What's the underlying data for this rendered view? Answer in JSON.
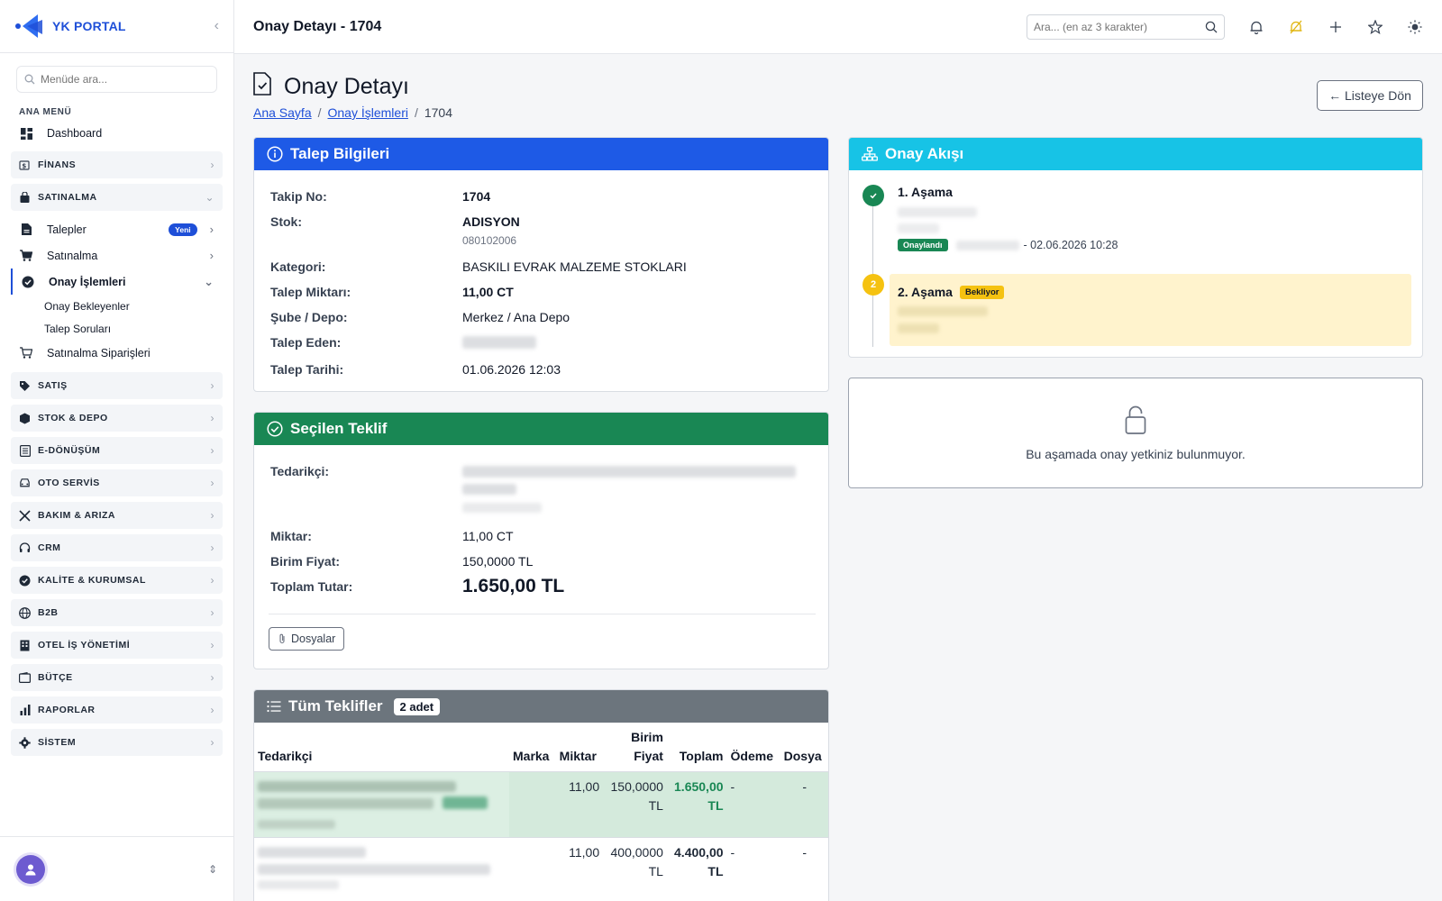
{
  "brand": {
    "name": "YK PORTAL"
  },
  "sidebar": {
    "search_placeholder": "Menüde ara...",
    "section_title": "ANA MENÜ",
    "dashboard": "Dashboard",
    "groups": {
      "finans": "FİNANS",
      "satinalma": "SATINALMA",
      "satis": "SATIŞ",
      "stok": "STOK & DEPO",
      "edonusum": "E-DÖNÜŞÜM",
      "oto": "OTO SERVİS",
      "bakim": "BAKIM & ARIZA",
      "crm": "CRM",
      "kalite": "KALİTE & KURUMSAL",
      "b2b": "B2B",
      "otel": "OTEL İŞ YÖNETİMİ",
      "butce": "BÜTÇE",
      "raporlar": "RAPORLAR",
      "sistem": "SİSTEM"
    },
    "satinalma_items": {
      "talepler": "Talepler",
      "talepler_badge": "Yeni",
      "satinalma": "Satınalma",
      "onay": "Onay İşlemleri",
      "onay_bekleyenler": "Onay Bekleyenler",
      "talep_sorulari": "Talep Soruları",
      "siparisler": "Satınalma Siparişleri"
    }
  },
  "topbar": {
    "title": "Onay Detayı - 1704",
    "search_placeholder": "Ara... (en az 3 karakter)"
  },
  "page": {
    "title": "Onay Detayı",
    "breadcrumb": {
      "home": "Ana Sayfa",
      "section": "Onay İşlemleri",
      "current": "1704"
    },
    "back_label": "← Listeye Dön"
  },
  "talep": {
    "header": "Talep Bilgileri",
    "takip_label": "Takip No:",
    "takip_value": "1704",
    "stok_label": "Stok:",
    "stok_value": "ADISYON",
    "stok_code": "080102006",
    "kategori_label": "Kategori:",
    "kategori_value": "BASKILI EVRAK MALZEME STOKLARI",
    "miktar_label": "Talep Miktarı:",
    "miktar_value": "11,00 CT",
    "sube_label": "Şube / Depo:",
    "sube_value": "Merkez / Ana Depo",
    "eden_label": "Talep Eden:",
    "tarih_label": "Talep Tarihi:",
    "tarih_value": "01.06.2026 12:03"
  },
  "secilen": {
    "header": "Seçilen Teklif",
    "tedarikci_label": "Tedarikçi:",
    "miktar_label": "Miktar:",
    "miktar_value": "11,00 CT",
    "birim_label": "Birim Fiyat:",
    "birim_value": "150,0000 TL",
    "toplam_label": "Toplam Tutar:",
    "toplam_value": "1.650,00 TL",
    "files_label": "Dosyalar"
  },
  "teklifler": {
    "header": "Tüm Teklifler",
    "count": "2 adet",
    "columns": {
      "tedarikci": "Tedarikçi",
      "marka": "Marka",
      "miktar": "Miktar",
      "birim_1": "Birim",
      "birim_2": "Fiyat",
      "toplam": "Toplam",
      "odeme": "Ödeme",
      "dosya": "Dosya"
    },
    "rows": [
      {
        "miktar": "11,00",
        "birim_1": "150,0000",
        "birim_2": "TL",
        "toplam_1": "1.650,00",
        "toplam_2": "TL",
        "odeme": "-",
        "dosya": "-"
      },
      {
        "miktar": "11,00",
        "birim_1": "400,0000",
        "birim_2": "TL",
        "toplam_1": "4.400,00",
        "toplam_2": "TL",
        "odeme": "-",
        "dosya": "-"
      }
    ]
  },
  "akis": {
    "header": "Onay Akışı",
    "step1": {
      "num": "1",
      "title": "1. Aşama",
      "status": "Onaylandı",
      "date": "- 02.06.2026 10:28"
    },
    "step2": {
      "num": "2",
      "title": "2. Aşama",
      "status": "Bekliyor"
    }
  },
  "yetki": {
    "message": "Bu aşamada onay yetkiniz bulunmuyor."
  },
  "colors": {
    "primary": "#1e4fd8",
    "success": "#198754",
    "info": "#17c3e6",
    "secondary": "#6b7280",
    "warning": "#f5c211",
    "warning_bg": "#fff3cd"
  }
}
